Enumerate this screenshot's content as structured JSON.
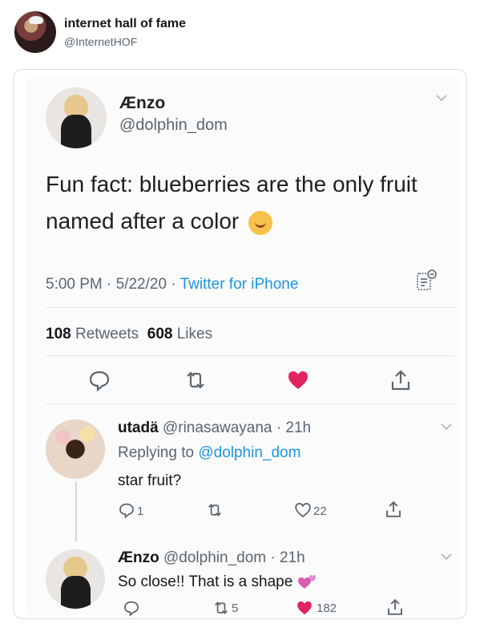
{
  "poster": {
    "name": "internet hall of fame",
    "handle": "@InternetHOF"
  },
  "tweet": {
    "author_name": "Ænzo",
    "author_handle": "@dolphin_dom",
    "text_line1": "Fun fact: blueberries are the only fruit",
    "text_line2": "named after a color",
    "time": "5:00 PM · 5/22/20 · ",
    "source": "Twitter for iPhone",
    "retweets_count": "108",
    "retweets_label": "Retweets",
    "likes_count": "608",
    "likes_label": "Likes",
    "like_color": "#e0245e"
  },
  "reply1": {
    "name": "utadä",
    "handle_time": "@rinasawayana · 21h",
    "replying_prefix": "Replying to ",
    "replying_handle": "@dolphin_dom",
    "text": "star fruit?",
    "reply_count": "1",
    "like_count": "22"
  },
  "reply2": {
    "name": "Ænzo",
    "handle_time": "@dolphin_dom · 21h",
    "text": "So close!! That is a shape",
    "retweet_count": "5",
    "like_count": "182"
  },
  "icons": {
    "reply": "reply-icon",
    "retweet": "retweet-icon",
    "like": "heart-icon",
    "share": "share-icon",
    "analytics": "analytics-icon",
    "chevron": "chevron-down-icon"
  }
}
